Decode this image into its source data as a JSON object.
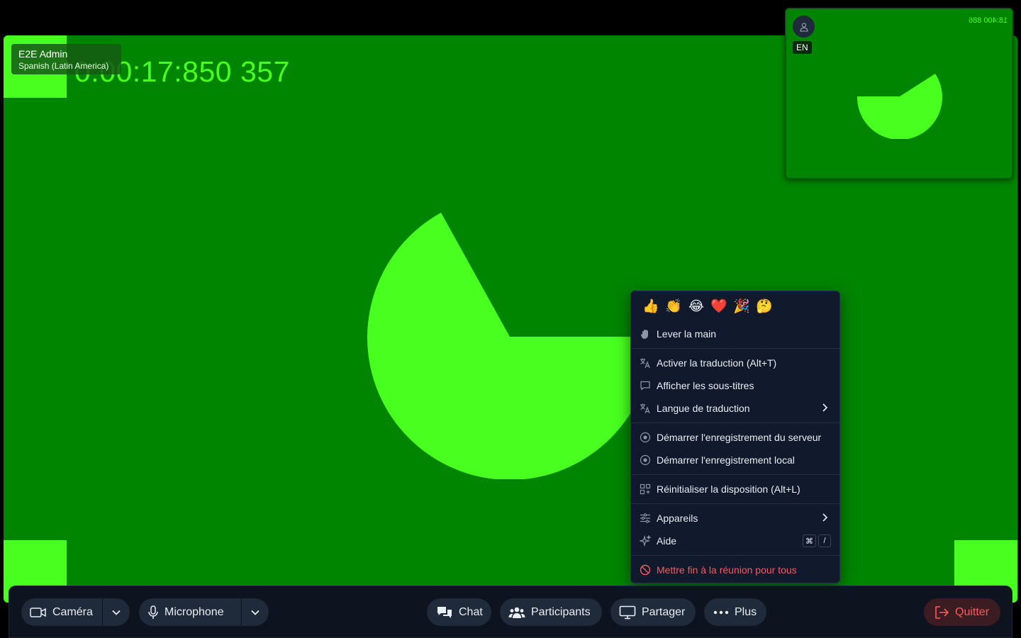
{
  "stage": {
    "timecode": "0:00:17:850 357",
    "participant_name": "E2E Admin",
    "participant_language": "Spanish (Latin America)"
  },
  "pip": {
    "language_badge": "EN",
    "timecode_mirrored": "18:400 886"
  },
  "menu": {
    "reactions": [
      "👍",
      "👏",
      "😂",
      "❤️",
      "🎉",
      "🤔"
    ],
    "raise_hand": "Lever la main",
    "activate_translation": "Activer la traduction (Alt+T)",
    "show_subtitles": "Afficher les sous-titres",
    "translation_language": "Langue de traduction",
    "start_server_recording": "Démarrer l'enregistrement du serveur",
    "start_local_recording": "Démarrer l'enregistrement local",
    "reset_layout": "Réinitialiser la disposition (Alt+L)",
    "devices": "Appareils",
    "help": "Aide",
    "help_shortcut_key1": "⌘",
    "help_shortcut_key2": "/",
    "end_meeting": "Mettre fin à la réunion pour tous"
  },
  "toolbar": {
    "camera": "Caméra",
    "microphone": "Microphone",
    "chat": "Chat",
    "participants": "Participants",
    "share": "Partager",
    "more": "Plus",
    "quit": "Quitter"
  },
  "colors": {
    "video_background": "#008500",
    "pattern_green": "#48ff1f",
    "menu_background": "#111a2c",
    "toolbar_background": "#0d1420",
    "danger": "#f25c5c"
  }
}
